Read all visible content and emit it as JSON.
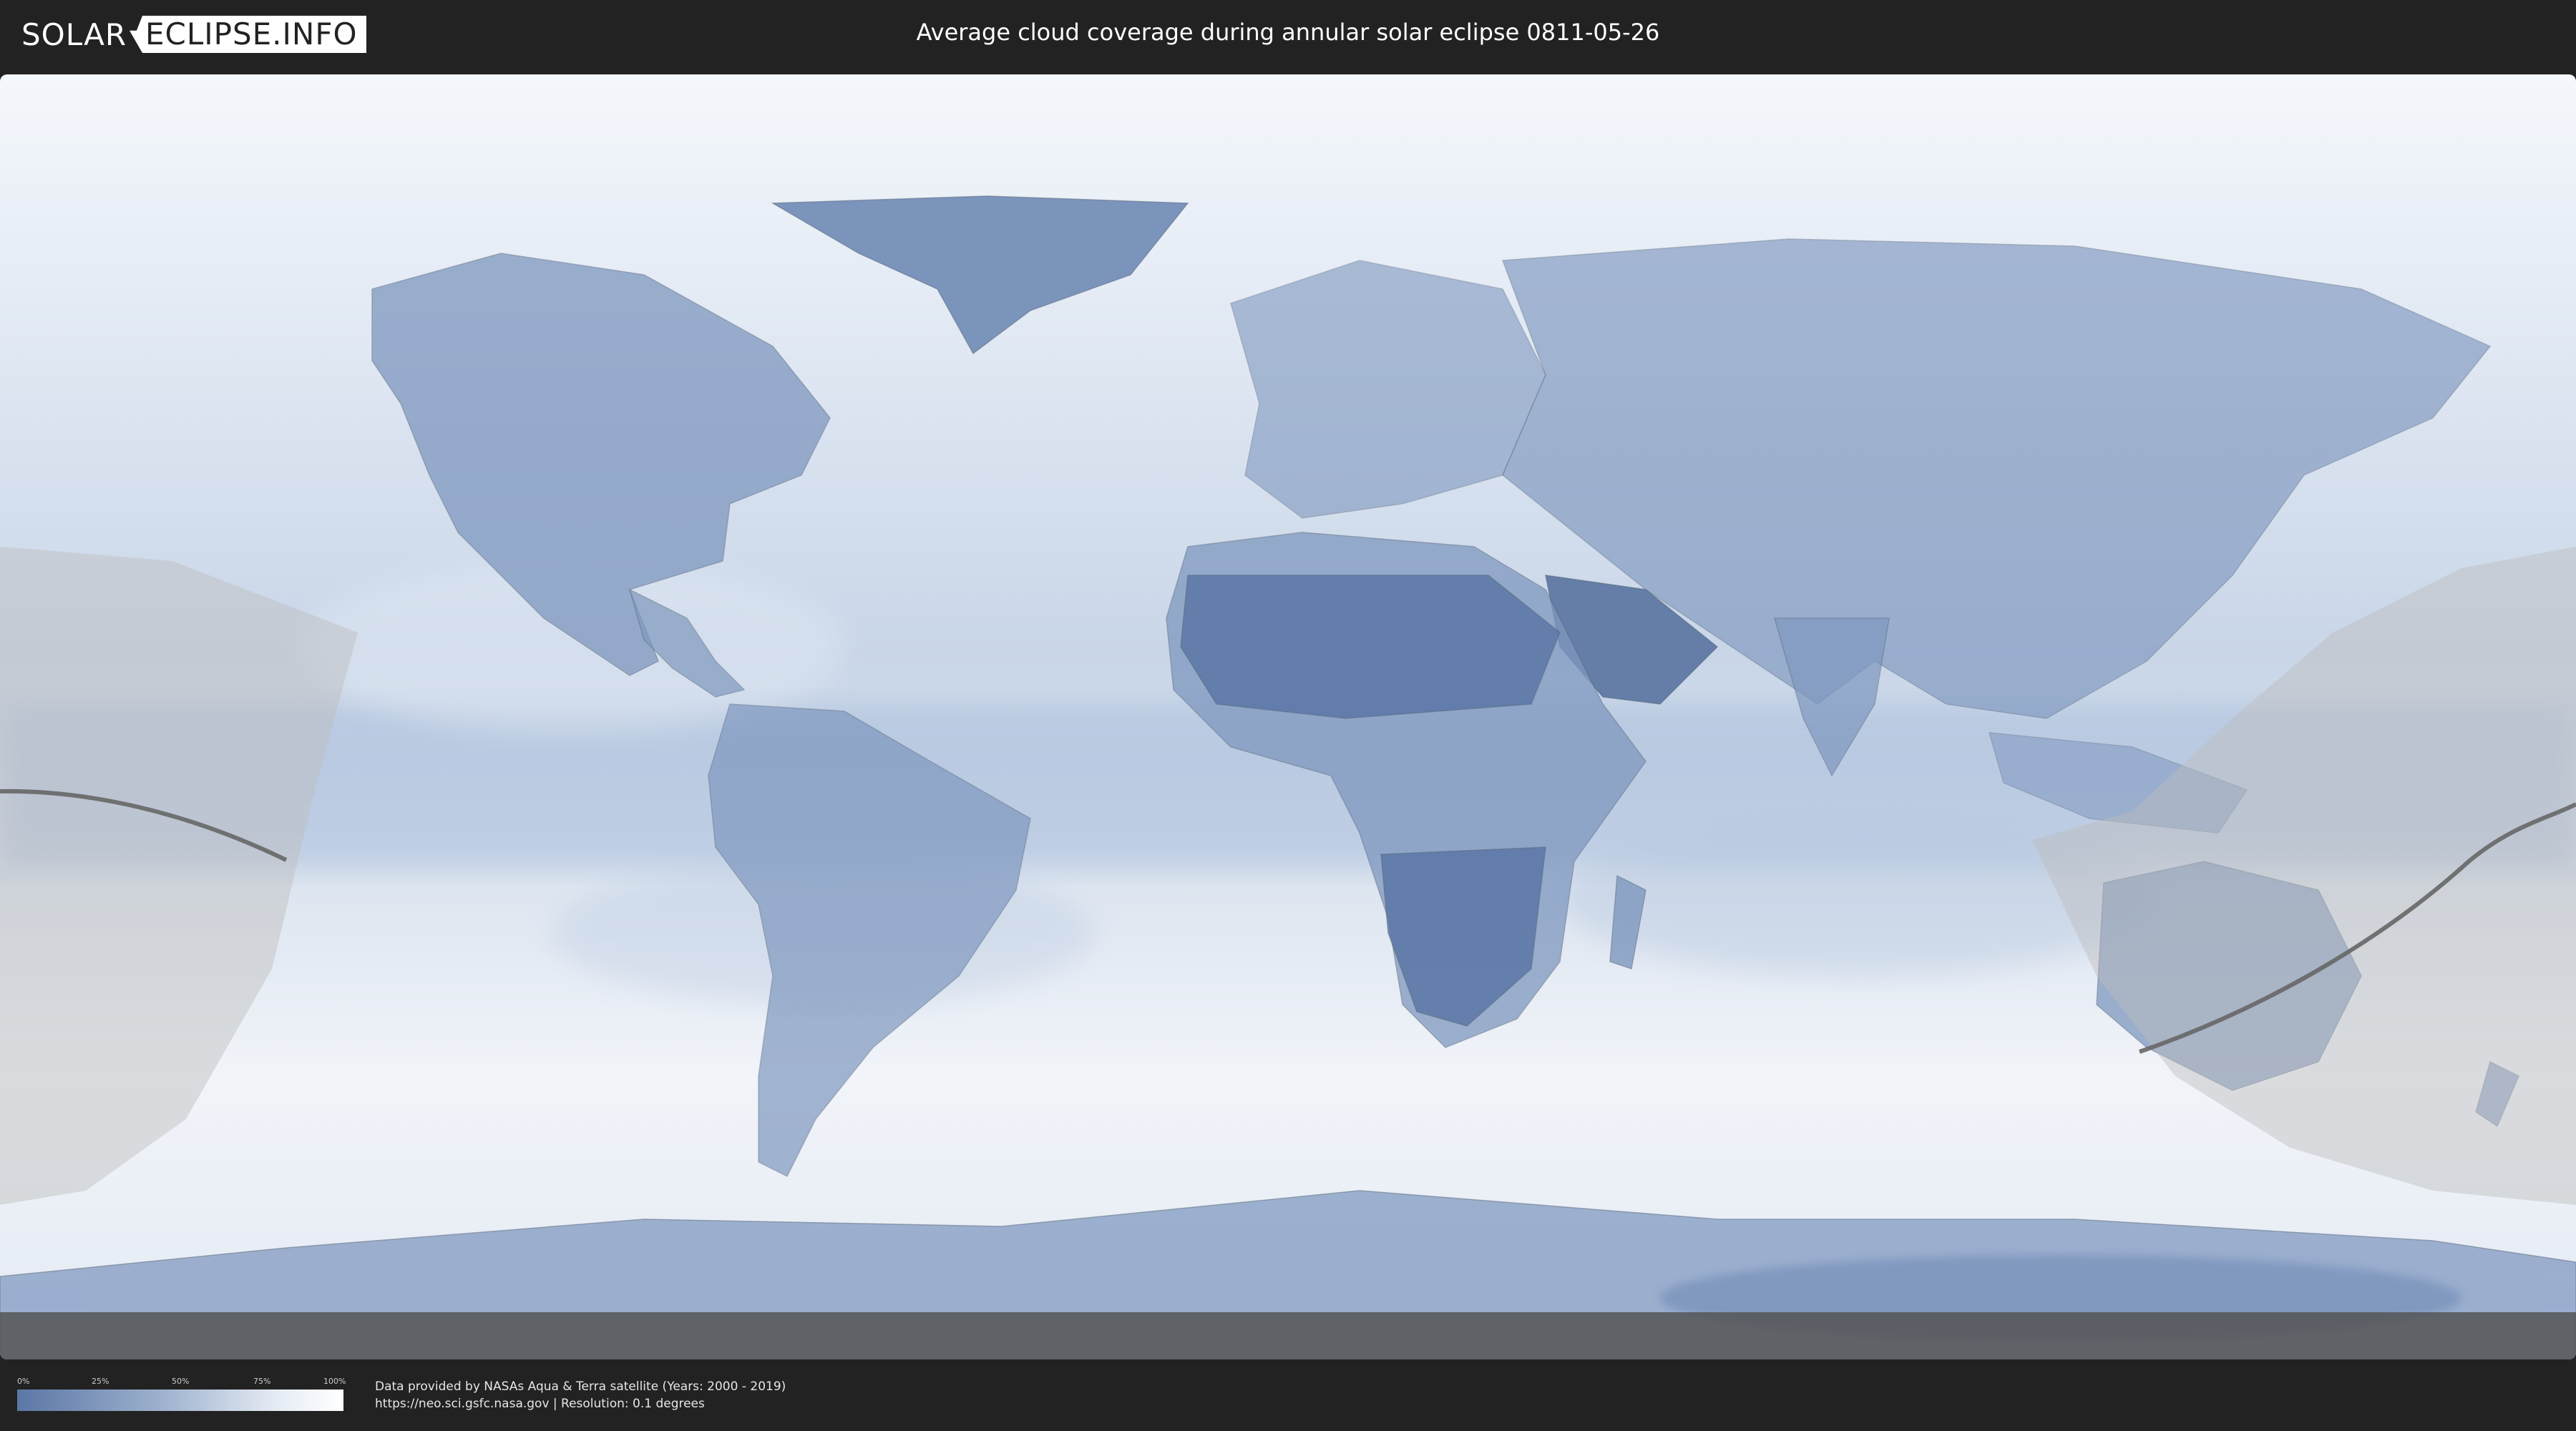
{
  "header": {
    "logo_left": "SOLAR",
    "logo_right": "ECLIPSE.INFO",
    "title": "Average cloud coverage during annular solar eclipse 0811-05-26"
  },
  "map": {
    "subject": "world cloud coverage map",
    "land_color": "#5f7aa5",
    "cloud_color": "#ffffff",
    "shadow_color": "#bfbfbf",
    "path_color": "#666666"
  },
  "legend": {
    "ticks": [
      "0%",
      "25%",
      "50%",
      "75%",
      "100%"
    ],
    "colors": [
      "#5b77a6",
      "#ffffff"
    ]
  },
  "footer": {
    "line1": "Data provided by NASAs Aqua & Terra satellite (Years: 2000 - 2019)",
    "line2": "https://neo.sci.gsfc.nasa.gov | Resolution: 0.1 degrees"
  }
}
